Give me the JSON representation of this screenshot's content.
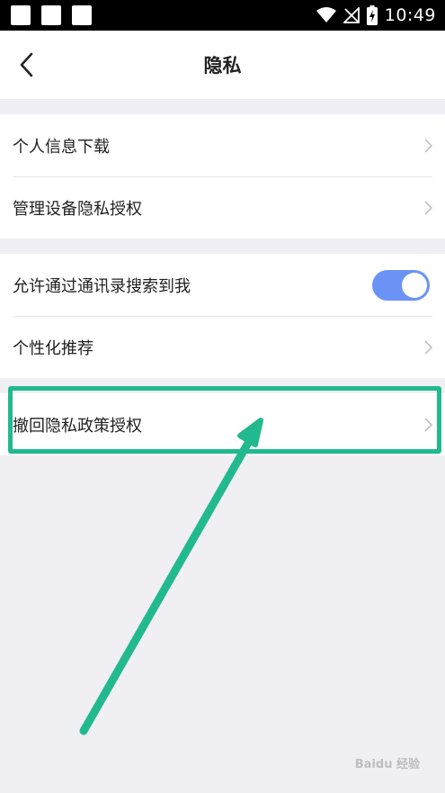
{
  "status_bar": {
    "time": "10:49",
    "icons": [
      "wifi-icon",
      "no-signal-icon",
      "battery-charging-icon"
    ]
  },
  "header": {
    "title": "隐私",
    "back_icon": "chevron-left-icon"
  },
  "group1": {
    "items": [
      {
        "label": "个人信息下载"
      },
      {
        "label": "管理设备隐私授权"
      }
    ]
  },
  "group2": {
    "items": [
      {
        "label": "允许通过通讯录搜索到我",
        "toggle_on": true
      },
      {
        "label": "个性化推荐"
      }
    ]
  },
  "group3": {
    "items": [
      {
        "label": "撤回隐私政策授权"
      }
    ]
  },
  "colors": {
    "toggle_on": "#6a93f5",
    "annotation": "#22b98e",
    "background": "#efeff4"
  }
}
